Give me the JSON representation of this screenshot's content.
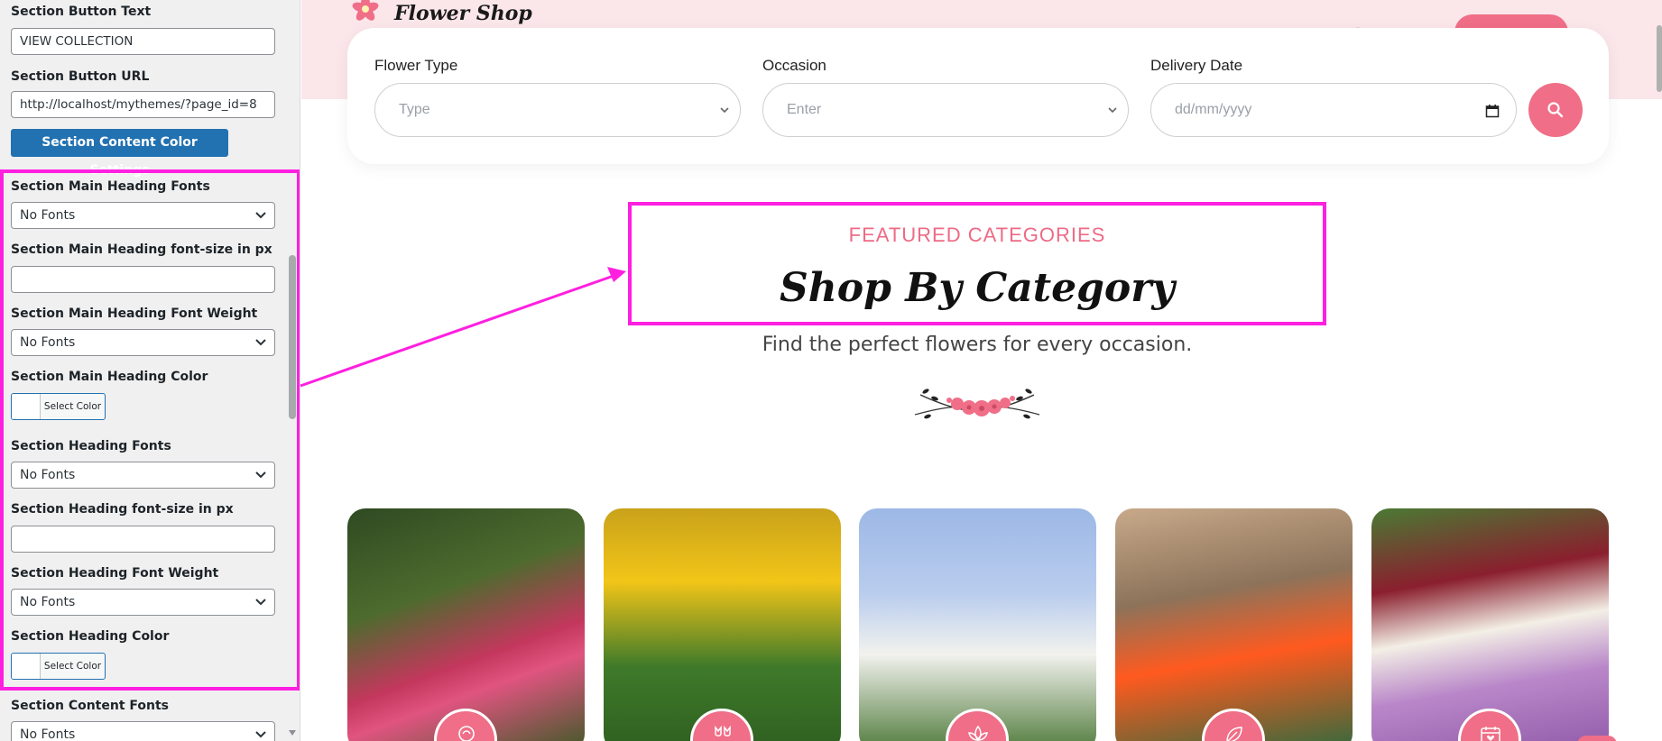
{
  "sidebar": {
    "button_text_label": "Section Button Text",
    "button_text_value": "VIEW COLLECTION",
    "button_url_label": "Section Button URL",
    "button_url_value": "http://localhost/mythemes/?page_id=8",
    "color_settings_button": "Section Content Color Settings",
    "fields": [
      {
        "label": "Section Main Heading Fonts",
        "type": "select",
        "value": "No Fonts"
      },
      {
        "label": "Section Main Heading font-size in px",
        "type": "input",
        "value": ""
      },
      {
        "label": "Section Main Heading Font Weight",
        "type": "select",
        "value": "No Fonts"
      },
      {
        "label": "Section Main Heading Color",
        "type": "color",
        "value": "Select Color"
      },
      {
        "label": "Section Heading Fonts",
        "type": "select",
        "value": "No Fonts"
      },
      {
        "label": "Section Heading font-size in px",
        "type": "input",
        "value": ""
      },
      {
        "label": "Section Heading Font Weight",
        "type": "select",
        "value": "No Fonts"
      },
      {
        "label": "Section Heading Color",
        "type": "color",
        "value": "Select Color"
      },
      {
        "label": "Section Content Fonts",
        "type": "select",
        "value": "No Fonts"
      }
    ]
  },
  "preview": {
    "logo_text": "Flower Shop",
    "search": {
      "flower_type_label": "Flower Type",
      "flower_type_placeholder": "Type",
      "occasion_label": "Occasion",
      "occasion_placeholder": "Enter",
      "delivery_label": "Delivery Date",
      "delivery_placeholder": "dd/mm/yyyy"
    },
    "section": {
      "eyebrow": "FEATURED CATEGORIES",
      "heading": "Shop By Category",
      "subheading": "Find the perfect flowers for every occasion."
    },
    "categories": [
      {
        "icon": "rose-icon"
      },
      {
        "icon": "tulip-icon"
      },
      {
        "icon": "lotus-icon"
      },
      {
        "icon": "leaf-icon"
      },
      {
        "icon": "calendar-heart-icon"
      }
    ]
  },
  "colors": {
    "accent_pink": "#f06e87",
    "highlight_magenta": "#ff1fe0",
    "wp_blue": "#2271b1"
  }
}
